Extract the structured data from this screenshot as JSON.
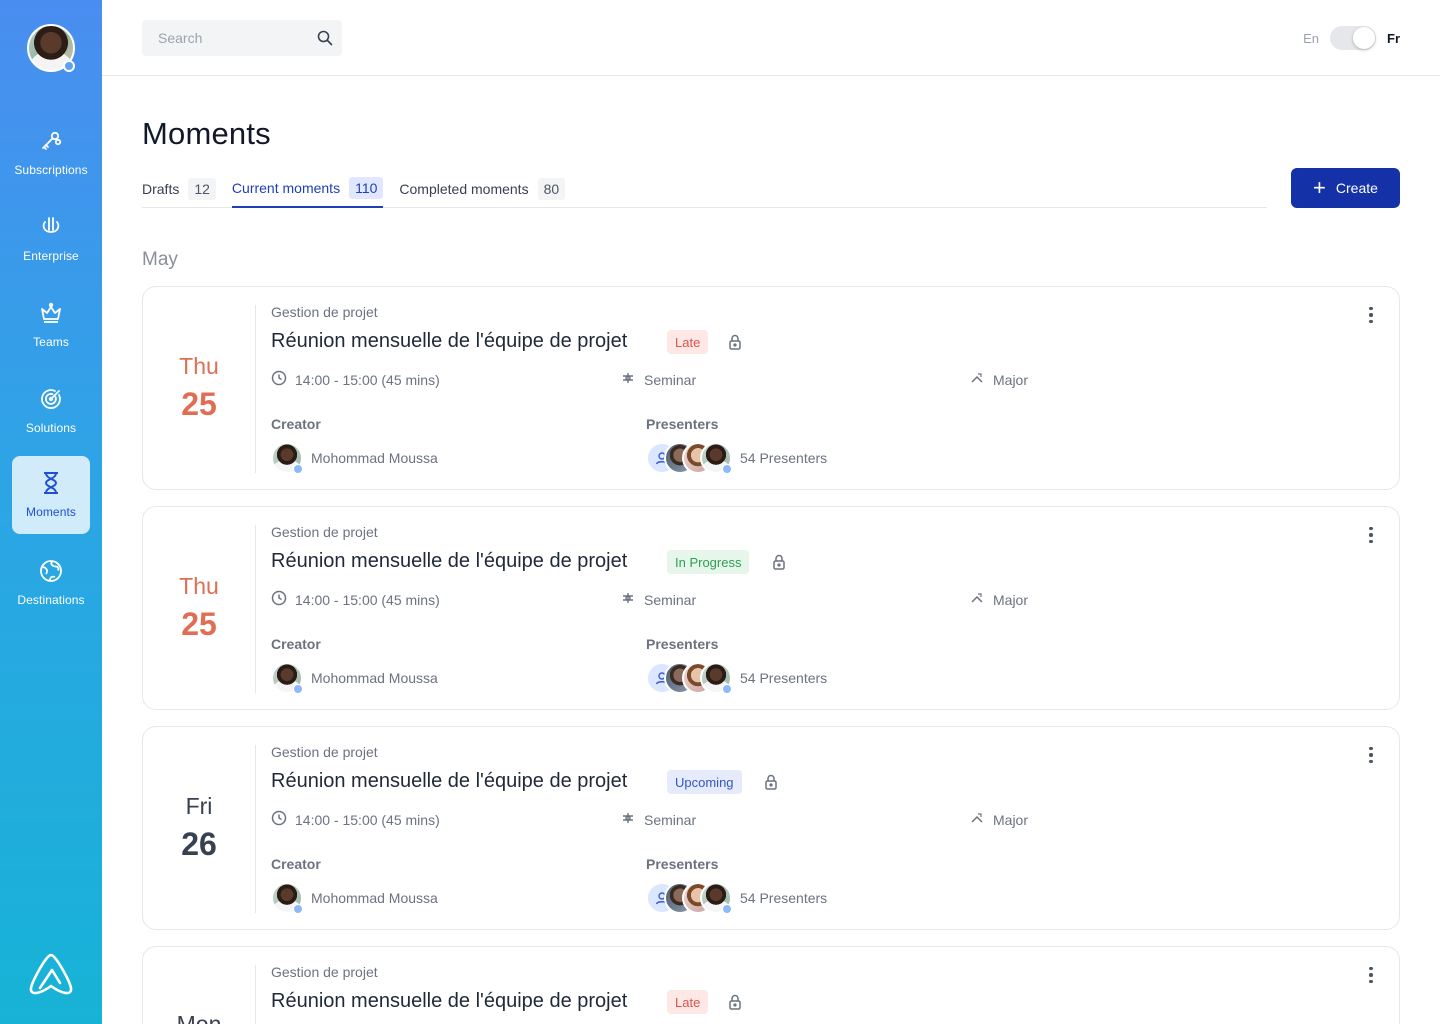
{
  "sidebar": {
    "items": [
      {
        "label": "Subscriptions",
        "icon": "key-icon"
      },
      {
        "label": "Enterprise",
        "icon": "enterprise-icon"
      },
      {
        "label": "Teams",
        "icon": "crown-icon"
      },
      {
        "label": "Solutions",
        "icon": "target-icon"
      },
      {
        "label": "Moments",
        "icon": "hourglass-icon",
        "active": true
      },
      {
        "label": "Destinations",
        "icon": "globe-icon"
      }
    ]
  },
  "topbar": {
    "search_placeholder": "Search",
    "lang_en": "En",
    "lang_fr": "Fr"
  },
  "page": {
    "title": "Moments",
    "create_label": "Create",
    "tabs": [
      {
        "label": "Drafts",
        "count": "12"
      },
      {
        "label": "Current moments",
        "count": "110",
        "active": true
      },
      {
        "label": "Completed moments",
        "count": "80"
      }
    ],
    "month": "May"
  },
  "cards": [
    {
      "day": "Thu",
      "date": "25",
      "category": "Gestion de projet",
      "title": "Réunion mensuelle de l'équipe de projet",
      "status": "Late",
      "time": "14:00 - 15:00 (45 mins)",
      "type": "Seminar",
      "level": "Major",
      "creator_label": "Creator",
      "creator": "Mohommad Moussa",
      "presenters_label": "Presenters",
      "presenters": "54 Presenters"
    },
    {
      "day": "Thu",
      "date": "25",
      "category": "Gestion de projet",
      "title": "Réunion mensuelle de l'équipe de projet",
      "status": "In Progress",
      "time": "14:00 - 15:00 (45 mins)",
      "type": "Seminar",
      "level": "Major",
      "creator_label": "Creator",
      "creator": "Mohommad Moussa",
      "presenters_label": "Presenters",
      "presenters": "54 Presenters"
    },
    {
      "day": "Fri",
      "date": "26",
      "category": "Gestion de projet",
      "title": "Réunion mensuelle de l'équipe de projet",
      "status": "Upcoming",
      "time": "14:00 - 15:00 (45 mins)",
      "type": "Seminar",
      "level": "Major",
      "creator_label": "Creator",
      "creator": "Mohommad Moussa",
      "presenters_label": "Presenters",
      "presenters": "54 Presenters"
    },
    {
      "day": "Mon",
      "date": "",
      "category": "Gestion de projet",
      "title": "Réunion mensuelle de l'équipe de projet",
      "status": "Late"
    }
  ],
  "colors": {
    "accent": "#1431a8",
    "late": "#d9534f",
    "in_progress": "#2f9e53",
    "upcoming": "#3456c6",
    "date_highlight": "#e06e55"
  }
}
